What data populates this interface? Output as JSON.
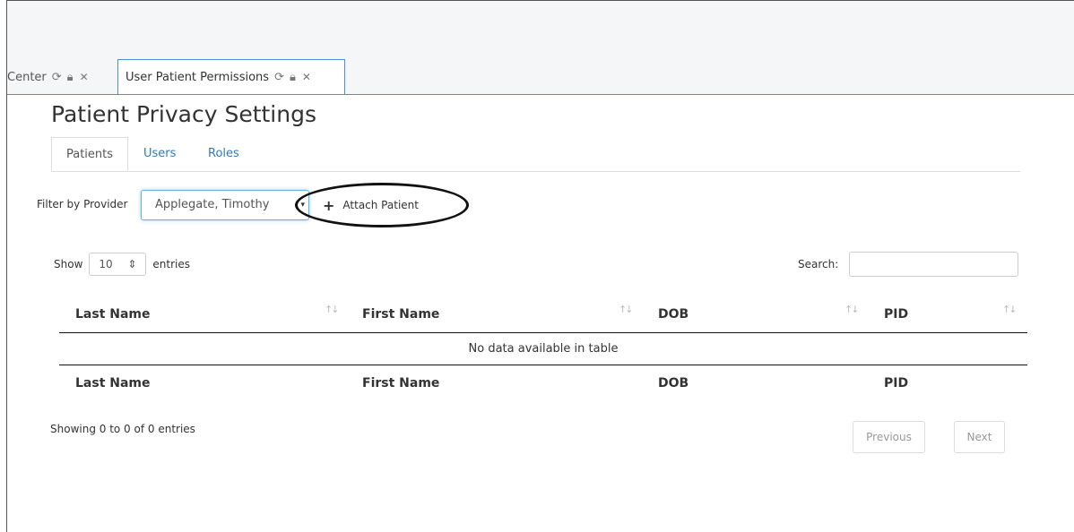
{
  "tabs": [
    {
      "label": "Center",
      "refresh_icon": "refresh-icon",
      "lock_icon": "lock-icon",
      "close_icon": "close-icon"
    },
    {
      "label": "User Patient Permissions",
      "refresh_icon": "refresh-icon",
      "lock_icon": "lock-icon",
      "close_icon": "close-icon"
    }
  ],
  "page": {
    "title": "Patient Privacy Settings"
  },
  "subtabs": [
    "Patients",
    "Users",
    "Roles"
  ],
  "filter": {
    "label": "Filter by Provider",
    "value": "Applegate, Timothy"
  },
  "attach_button": {
    "label": "Attach Patient"
  },
  "length": {
    "show": "Show",
    "value": "10",
    "entries": "entries"
  },
  "search": {
    "label": "Search:",
    "value": ""
  },
  "table": {
    "headers": [
      "Last Name",
      "First Name",
      "DOB",
      "PID"
    ],
    "empty_message": "No data available in table",
    "footers": [
      "Last Name",
      "First Name",
      "DOB",
      "PID"
    ]
  },
  "info": "Showing 0 to 0 of 0 entries",
  "pagination": {
    "previous": "Previous",
    "next": "Next"
  },
  "colors": {
    "accent": "#4a90d9",
    "link": "#337ab7"
  }
}
